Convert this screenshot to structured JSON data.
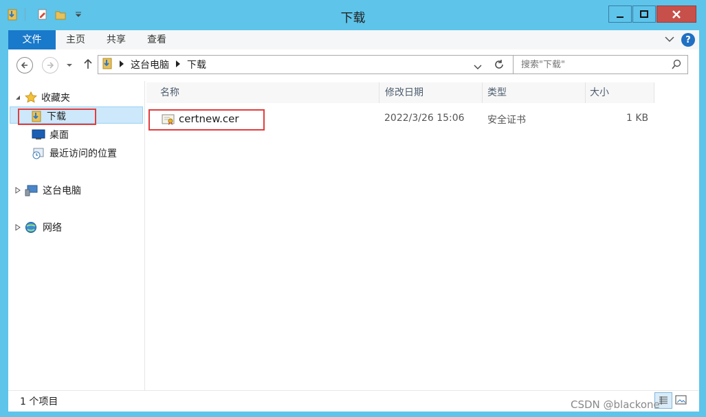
{
  "window": {
    "title": "下载",
    "minimize": "minimize",
    "maximize": "maximize",
    "close": "close"
  },
  "ribbon": {
    "tabs": [
      "文件",
      "主页",
      "共享",
      "查看"
    ],
    "help": "?"
  },
  "navigation": {
    "breadcrumb": [
      "这台电脑",
      "下载"
    ],
    "search_placeholder": "搜索\"下载\""
  },
  "sidebar": {
    "favorites_label": "收藏夹",
    "favorites_items": [
      {
        "label": "下载",
        "icon": "downloads-folder-icon",
        "selected": true
      },
      {
        "label": "桌面",
        "icon": "desktop-icon"
      },
      {
        "label": "最近访问的位置",
        "icon": "recent-places-icon"
      }
    ],
    "this_pc_label": "这台电脑",
    "network_label": "网络"
  },
  "file_list": {
    "columns": [
      "名称",
      "修改日期",
      "类型",
      "大小"
    ],
    "rows": [
      {
        "name": "certnew.cer",
        "modified": "2022/3/26 15:06",
        "type": "安全证书",
        "size": "1 KB",
        "icon": "certificate-icon"
      }
    ]
  },
  "status": {
    "item_count": "1 个项目"
  },
  "watermark": "CSDN @blackone",
  "colors": {
    "titlebar": "#5ec4ea",
    "file_tab": "#1979ca",
    "close_button": "#c7504b",
    "selection": "#cce8fa",
    "highlight_box": "#e23c3c"
  }
}
